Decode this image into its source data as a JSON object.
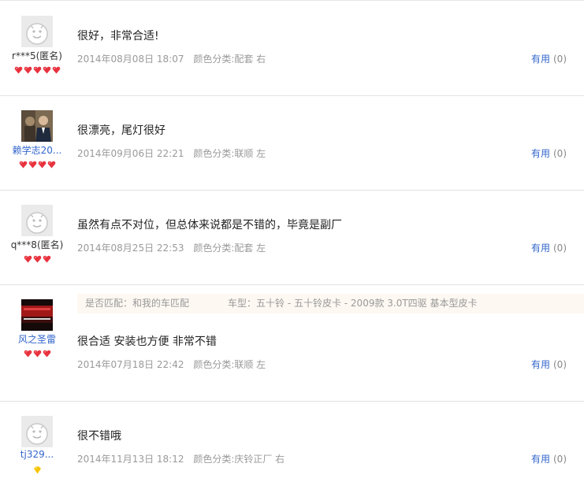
{
  "reviews": [
    {
      "username": "r***5(匿名)",
      "avatar": "default-avatar-icon",
      "gem_count": 5,
      "gem_type": "red-heart-gem",
      "content": "很好，非常合适!",
      "date": "2014年08月08日 18:07",
      "color_category": "颜色分类:配套 右",
      "useful_label": "有用",
      "useful_count": "(0)"
    },
    {
      "username": "赖学志20...",
      "avatar": "user-photo",
      "gem_count": 4,
      "gem_type": "red-heart-gem",
      "content": "很漂亮，尾灯很好",
      "date": "2014年09月06日 22:21",
      "color_category": "颜色分类:联顺 左",
      "useful_label": "有用",
      "useful_count": "(0)"
    },
    {
      "username": "q***8(匿名)",
      "avatar": "default-avatar-icon",
      "gem_count": 3,
      "gem_type": "red-heart-gem",
      "content": "虽然有点不对位，但总体来说都是不错的，毕竟是副厂",
      "date": "2014年08月25日 22:53",
      "color_category": "颜色分类:配套 左",
      "useful_label": "有用",
      "useful_count": "(0)"
    },
    {
      "username": "风之圣雷",
      "avatar": "user-photo",
      "gem_count": 3,
      "gem_type": "red-heart-gem",
      "match_info": "是否匹配：和我的车匹配",
      "car_model": "车型：五十铃 - 五十铃皮卡 - 2009款 3.0T四驱 基本型皮卡",
      "content": "很合适 安装也方便 非常不错",
      "date": "2014年07月18日 22:42",
      "color_category": "颜色分类:联顺 左",
      "useful_label": "有用",
      "useful_count": "(0)"
    },
    {
      "username": "tj329...",
      "avatar": "default-avatar-icon",
      "gem_count": 1,
      "gem_type": "yellow-diamond",
      "content": "很不错哦",
      "date": "2014年11月13日 18:12",
      "color_category": "颜色分类:庆铃正厂 右",
      "useful_label": "有用",
      "useful_count": "(0)"
    }
  ],
  "colors": {
    "link": "#3366cc",
    "meta": "#9a9a9a",
    "gem_red": "#e8333f",
    "gem_yellow": "#f5c400",
    "match_bg": "#fdf8f2"
  }
}
